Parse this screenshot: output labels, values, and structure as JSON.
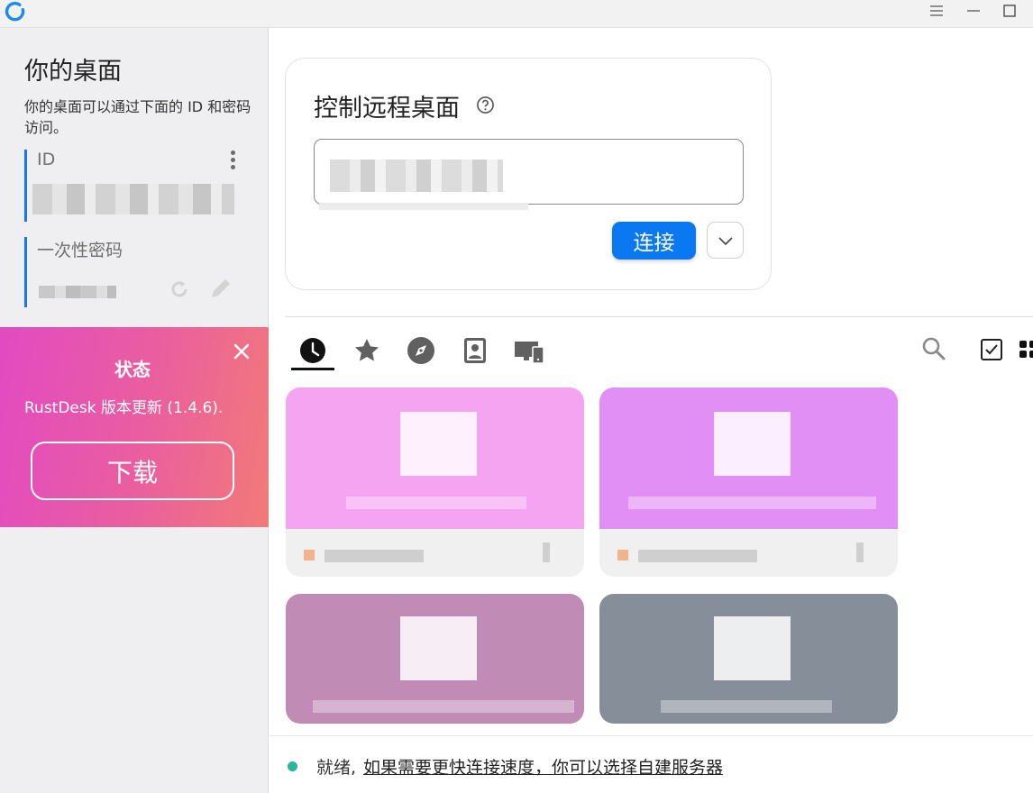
{
  "titlebar": {
    "logo_icon": "rustdesk-logo-icon",
    "menu_icon": "hamburger-icon",
    "minimize_icon": "minimize-icon",
    "maximize_icon": "maximize-icon"
  },
  "left": {
    "title": "你的桌面",
    "description": "你的桌面可以通过下面的 ID 和密码访问。",
    "id_label": "ID",
    "id_value": "",
    "password_label": "一次性密码",
    "password_value": "",
    "refresh_icon": "refresh-icon",
    "edit_icon": "pencil-icon",
    "more_icon": "more-vertical-icon"
  },
  "status_card": {
    "title": "状态",
    "message": "RustDesk 版本更新 (1.4.6).",
    "button": "下载",
    "close_icon": "close-icon",
    "gradient_start": "#e24ac2",
    "gradient_end": "#f27a78"
  },
  "control": {
    "title": "控制远程桌面",
    "help_icon": "help-circle-icon",
    "input_value": "",
    "connect_label": "连接",
    "more_icon": "chevron-down-icon",
    "accent": "#0a79f1"
  },
  "tabs": [
    {
      "name": "recent",
      "icon": "clock-icon",
      "active": true
    },
    {
      "name": "favorites",
      "icon": "star-icon",
      "active": false
    },
    {
      "name": "discovered",
      "icon": "compass-icon",
      "active": false
    },
    {
      "name": "address-book",
      "icon": "contact-book-icon",
      "active": false
    },
    {
      "name": "devices",
      "icon": "devices-icon",
      "active": false
    }
  ],
  "toolbar": {
    "search_icon": "search-icon",
    "select_icon": "checkbox-icon",
    "grid_icon": "grid-view-icon"
  },
  "peers": [
    {
      "name": "",
      "color": "#f5a4f1"
    },
    {
      "name": "",
      "color": "#e28ff5"
    },
    {
      "name": "",
      "color": "#c08cb6"
    },
    {
      "name": "",
      "color": "#858e99"
    }
  ],
  "statusbar": {
    "ready": "就绪,",
    "link": "如果需要更快连接速度，你可以选择自建服务器",
    "dot_color": "#27b79c"
  }
}
